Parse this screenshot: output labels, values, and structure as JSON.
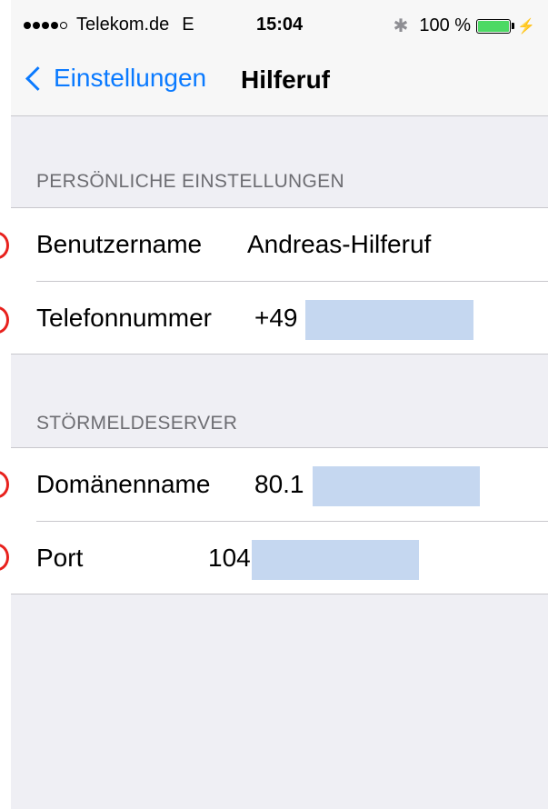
{
  "status_bar": {
    "carrier": "Telekom.de",
    "network": "E",
    "time": "15:04",
    "battery_percent": "100 %",
    "signal_bars": 4
  },
  "nav": {
    "back_label": "Einstellungen",
    "title": "Hilferuf"
  },
  "sections": [
    {
      "header": "PERSÖNLICHE EINSTELLUNGEN",
      "rows": [
        {
          "label": "Benutzername",
          "value": "Andreas-Hilferuf"
        },
        {
          "label": "Telefonnummer",
          "value": "+49"
        }
      ]
    },
    {
      "header": "STÖRMELDESERVER",
      "rows": [
        {
          "label": "Domänenname",
          "value": "80.1"
        },
        {
          "label": "Port",
          "value": "104"
        }
      ]
    }
  ],
  "colors": {
    "accent": "#0a7aff",
    "redaction": "#c5d7f0",
    "marker": "#e8211d",
    "background": "#efeff4"
  }
}
